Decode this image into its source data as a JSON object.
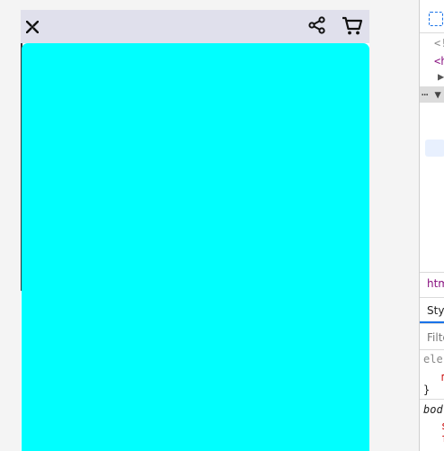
{
  "viewport": {
    "topbar_bg": "#e0e0ec",
    "content_color": "#00ffff",
    "icons": {
      "left": "close-x-icon",
      "share": "share-icon",
      "cart": "shopping-cart-icon"
    }
  },
  "devtools": {
    "lines": [
      "<!",
      "<h",
      "▶",
      "⋯ ▼"
    ],
    "breadcrumb": "htm",
    "tab_styles": "Sty",
    "filter_placeholder": "Filte",
    "rule1_selector": "ele",
    "rule1_prop": "m",
    "rule1_close": "}",
    "rule2_selector": "bod",
    "rule2_prop1": "s",
    "rule2_prop2": "f"
  }
}
